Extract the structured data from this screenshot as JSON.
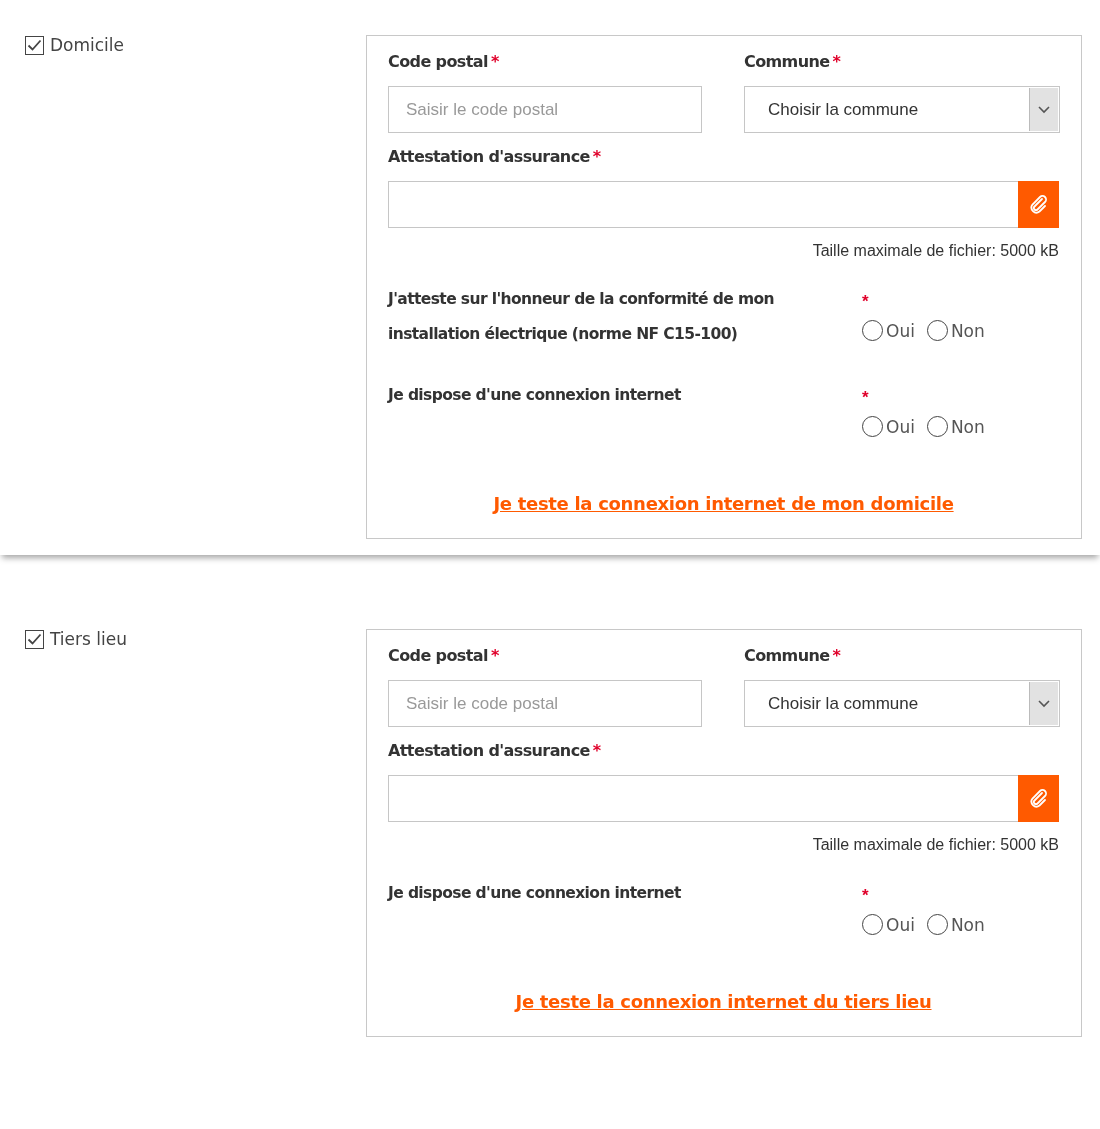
{
  "sections": [
    {
      "elevated": true,
      "option": {
        "label": "Domicile",
        "checked": true
      },
      "postal": {
        "label": "Code postal",
        "mark": "*",
        "placeholder": "Saisir le code postal"
      },
      "commune": {
        "label": "Commune",
        "mark": "*",
        "value": "Choisir la commune"
      },
      "attestation": {
        "label": "Attestation d'assurance",
        "mark": "*",
        "hint": "Taille maximale de fichier: 5000 kB"
      },
      "questions": [
        {
          "text": "J'atteste sur l'honneur de la conformité de mon installation électrique (norme NF C15-100)",
          "mark": "*",
          "options": [
            {
              "label": "Oui",
              "selected": false
            },
            {
              "label": "Non",
              "selected": false
            }
          ]
        },
        {
          "text": "Je dispose d'une connexion internet",
          "mark": "*",
          "options": [
            {
              "label": "Oui",
              "selected": false
            },
            {
              "label": "Non",
              "selected": false
            }
          ]
        }
      ],
      "link": "Je teste la connexion internet de mon domicile"
    },
    {
      "elevated": false,
      "option": {
        "label": "Tiers lieu",
        "checked": true
      },
      "postal": {
        "label": "Code postal",
        "mark": "*",
        "placeholder": "Saisir le code postal"
      },
      "commune": {
        "label": "Commune",
        "mark": "*",
        "value": "Choisir la commune"
      },
      "attestation": {
        "label": "Attestation d'assurance",
        "mark": "*",
        "hint": "Taille maximale de fichier: 5000 kB"
      },
      "questions": [
        {
          "text": "Je dispose d'une connexion internet",
          "mark": "*",
          "options": [
            {
              "label": "Oui",
              "selected": false
            },
            {
              "label": "Non",
              "selected": false
            }
          ]
        }
      ],
      "link": "Je teste la connexion internet du tiers lieu"
    }
  ]
}
